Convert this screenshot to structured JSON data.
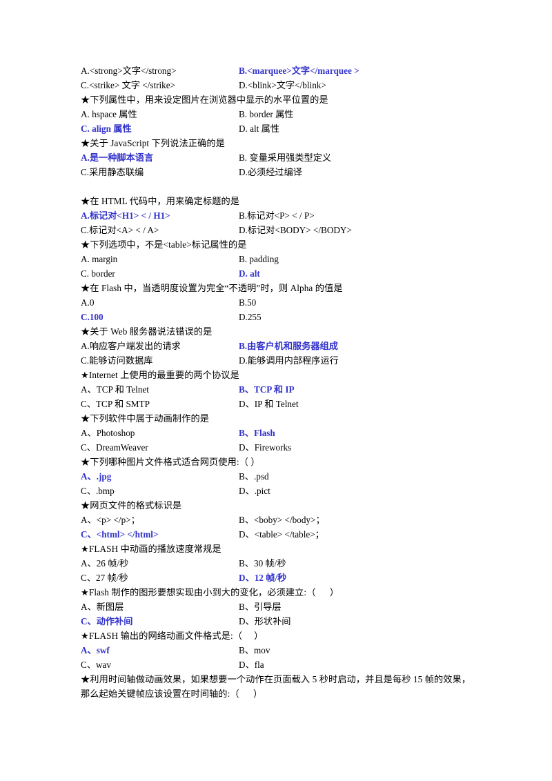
{
  "document": {
    "page_background": "#ffffff",
    "text_color": "#000000",
    "answer_color": "#3333cc",
    "star_glyph": "★"
  },
  "blocks": [
    {
      "id": "q-text-tags",
      "stem": null,
      "options": [
        {
          "left": "A.<strong>文字</strong>",
          "left_answer": false,
          "right": "B.<marquee>文字</marquee >",
          "right_answer": true
        },
        {
          "left": "C.<strike> 文字 </strike>",
          "left_answer": false,
          "right": "D.<blink>文字</blink>",
          "right_answer": false
        }
      ]
    },
    {
      "id": "q-image-align",
      "stem": "★下列属性中，用来设定图片在浏览器中显示的水平位置的是",
      "options": [
        {
          "left": "A. hspace 属性",
          "left_answer": false,
          "right": "B. border 属性",
          "right_answer": false
        },
        {
          "left": "C. align 属性",
          "left_answer": true,
          "right": "D. alt 属性",
          "right_answer": false
        }
      ]
    },
    {
      "id": "q-javascript",
      "stem": "★关于 JavaScript 下列说法正确的是",
      "options": [
        {
          "left": "A.是一种脚本语言",
          "left_answer": true,
          "right": "B. 变量采用强类型定义",
          "right_answer": false
        },
        {
          "left": "C.采用静态联编",
          "left_answer": false,
          "right": "D.必须经过编译",
          "right_answer": false
        }
      ]
    },
    {
      "id": "spacer-1",
      "spacer": true
    },
    {
      "id": "q-html-title",
      "stem": "★在 HTML 代码中，用来确定标题的是",
      "options": [
        {
          "left": "A.标记对<H1> < / H1>",
          "left_answer": true,
          "right": "B.标记对<P> < / P>",
          "right_answer": false
        },
        {
          "left": "C.标记对<A> < / A>",
          "left_answer": false,
          "right": "D.标记对<BODY> </BODY>",
          "right_answer": false
        }
      ]
    },
    {
      "id": "q-table-attr",
      "stem": "★下列选项中，不是<table>标记属性的是",
      "options": [
        {
          "left": "A. margin",
          "left_answer": false,
          "right": "B. padding",
          "right_answer": false
        },
        {
          "left": "C. border",
          "left_answer": false,
          "right": "D. alt",
          "right_answer": true
        }
      ]
    },
    {
      "id": "q-flash-alpha",
      "stem": "★在 Flash 中，当透明度设置为完全“不透明”时，则 Alpha 的值是",
      "options": [
        {
          "left": "A.0",
          "left_answer": false,
          "right": "B.50",
          "right_answer": false
        },
        {
          "left": "C.100",
          "left_answer": true,
          "right": "D.255",
          "right_answer": false
        }
      ]
    },
    {
      "id": "q-web-server",
      "stem": "★关于 Web 服务器说法错误的是",
      "options": [
        {
          "left": "A.响应客户端发出的请求",
          "left_answer": false,
          "right": "B.由客户机和服务器组成",
          "right_answer": true
        },
        {
          "left": "C.能够访问数据库",
          "left_answer": false,
          "right": "D.能够调用内部程序运行",
          "right_answer": false
        }
      ]
    },
    {
      "id": "q-internet-protocols",
      "stem": "★Internet 上使用的最重要的两个协议是",
      "options": [
        {
          "left": "A、TCP 和 Telnet",
          "left_answer": false,
          "right": "B、TCP 和 IP",
          "right_answer": true
        },
        {
          "left": "C、TCP 和 SMTP",
          "left_answer": false,
          "right": "D、IP 和 Telnet",
          "right_answer": false
        }
      ]
    },
    {
      "id": "q-animation-software",
      "stem": "★下列软件中属于动画制作的是",
      "options": [
        {
          "left": "A、Photoshop",
          "left_answer": false,
          "right": "B、Flash",
          "right_answer": true
        },
        {
          "left": "C、DreamWeaver",
          "left_answer": false,
          "right": "D、Fireworks",
          "right_answer": false
        }
      ]
    },
    {
      "id": "q-image-format",
      "stem": "★下列哪种图片文件格式适合网页使用:（ ）",
      "options": [
        {
          "left": "A、.jpg",
          "left_answer": true,
          "right": "B、.psd",
          "right_answer": false
        },
        {
          "left": "C、.bmp",
          "left_answer": false,
          "right": "D、.pict",
          "right_answer": false
        }
      ]
    },
    {
      "id": "q-webpage-tag",
      "stem": "★网页文件的格式标识是",
      "options": [
        {
          "left": "A、<p> </p>；",
          "left_answer": false,
          "right": "B、<boby> </body>；",
          "right_answer": false
        },
        {
          "left": "C、<html> </html>",
          "left_answer": true,
          "right": "D、<table> </table>；",
          "right_answer": false
        }
      ]
    },
    {
      "id": "q-flash-fps",
      "stem": "★FLASH 中动画的播放速度常规是",
      "options": [
        {
          "left": "A、26 帧/秒",
          "left_answer": false,
          "right": "B、30 帧/秒",
          "right_answer": false
        },
        {
          "left": "C、27 帧/秒",
          "left_answer": false,
          "right": "D、12 帧/秒",
          "right_answer": true
        }
      ]
    },
    {
      "id": "q-flash-tween",
      "stem": "★Flash 制作的图形要想实现由小到大的变化，必须建立:（      ）",
      "stem_bold_lead": true,
      "options": [
        {
          "left": "A、新图层",
          "left_answer": false,
          "right": "B、引导层",
          "right_answer": false
        },
        {
          "left": "C、动作补间",
          "left_answer": true,
          "right": "D、形状补间",
          "right_answer": false
        }
      ]
    },
    {
      "id": "q-flash-output",
      "stem": "★FLASH 输出的网络动画文件格式是:（     ）",
      "options": [
        {
          "left": "A、swf",
          "left_answer": true,
          "right": "B、mov",
          "right_answer": false
        },
        {
          "left": "C、wav",
          "left_answer": false,
          "right": "D、fla",
          "right_answer": false
        }
      ]
    },
    {
      "id": "q-timeline-keyframe",
      "stem": "★利用时间轴做动画效果，如果想要一个动作在页面载入 5 秒时启动，并且是每秒 15 帧的效果，那么起始关键帧应该设置在时间轴的:（      ）",
      "wrap": true,
      "options": []
    }
  ]
}
